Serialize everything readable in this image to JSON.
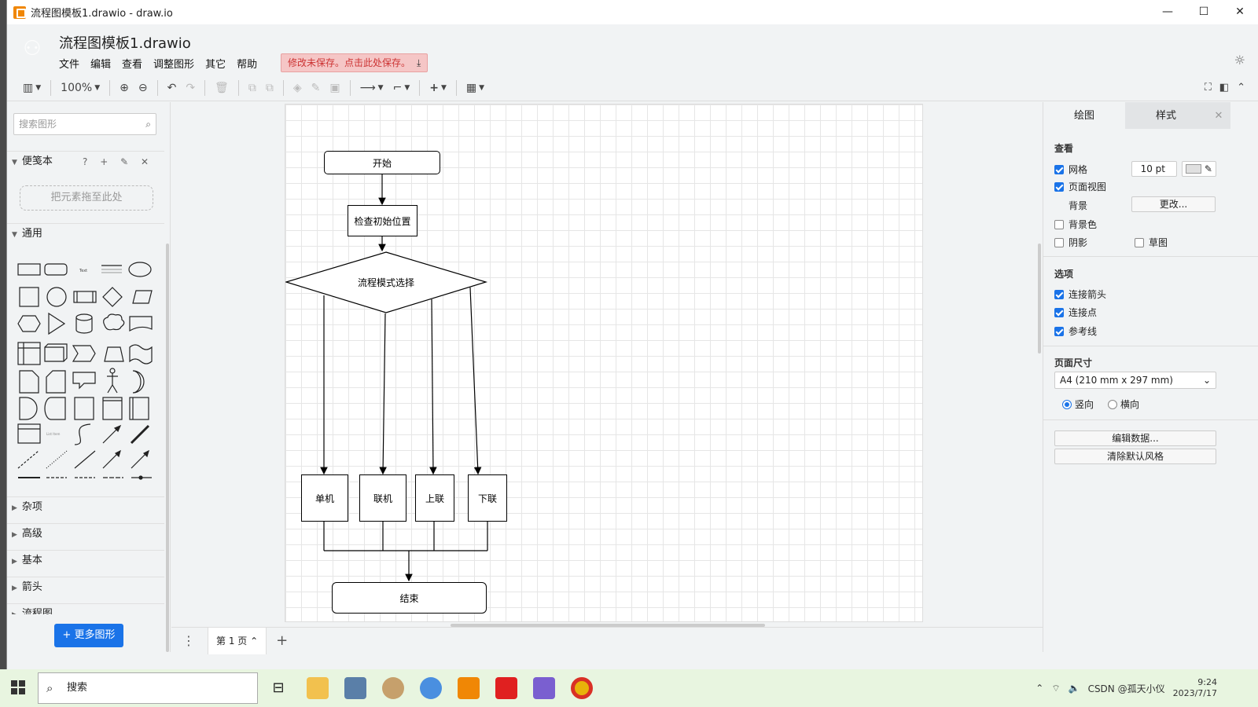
{
  "window": {
    "title": "流程图模板1.drawio - draw.io",
    "minimize": "—",
    "maximize": "☐",
    "close": "✕"
  },
  "header": {
    "filename": "流程图模板1.drawio",
    "menus": [
      "文件",
      "编辑",
      "查看",
      "调整图形",
      "其它",
      "帮助"
    ],
    "unsaved": "修改未保存。点击此处保存。"
  },
  "toolbar": {
    "zoom": "100%"
  },
  "sidebar": {
    "search_placeholder": "搜索图形",
    "scratchpad": "便笺本",
    "scratch_tools": "? + ✎ ✕",
    "dropzone": "把元素拖至此处",
    "general": "通用",
    "sections": [
      "杂项",
      "高级",
      "基本",
      "箭头",
      "流程图"
    ],
    "more_shapes": "+ 更多图形"
  },
  "diagram": {
    "start": "开始",
    "check": "检查初始位置",
    "decision": "流程模式选择",
    "branches": [
      "单机",
      "联机",
      "上联",
      "下联"
    ],
    "end": "结束"
  },
  "pages": {
    "current": "第 1 页"
  },
  "format": {
    "tabs": [
      "绘图",
      "样式"
    ],
    "view_title": "查看",
    "grid": "网格",
    "grid_size": "10 pt",
    "page_view": "页面视图",
    "background": "背景",
    "change": "更改...",
    "bg_color": "背景色",
    "shadow": "阴影",
    "sketch": "草图",
    "options_title": "选项",
    "connect_arrows": "连接箭头",
    "connect_points": "连接点",
    "guides": "参考线",
    "page_size_title": "页面尺寸",
    "page_size": "A4 (210 mm x 297 mm)",
    "portrait": "竖向",
    "landscape": "横向",
    "edit_data": "编辑数据...",
    "clear_style": "清除默认风格"
  },
  "taskbar": {
    "search": "搜索",
    "time": "9:24",
    "date": "2023/7/17",
    "watermark": "CSDN @孤天小仪"
  }
}
